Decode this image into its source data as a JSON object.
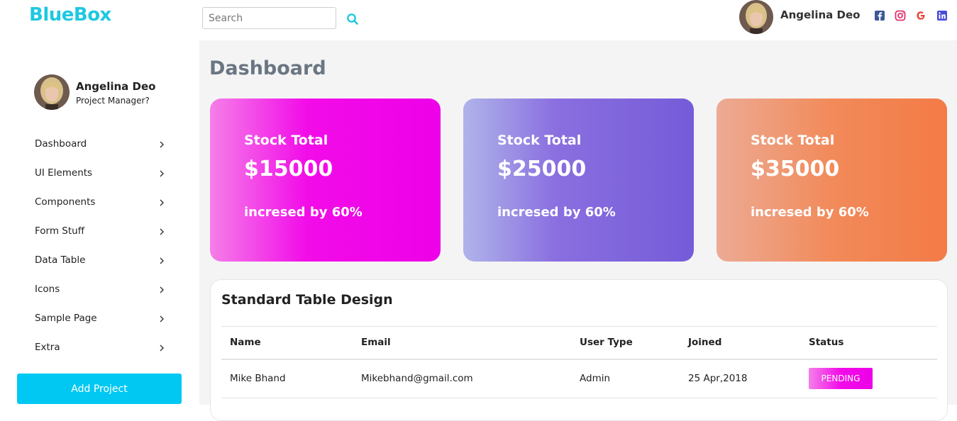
{
  "brand": {
    "name": "BlueBox"
  },
  "search": {
    "placeholder": "Search",
    "value": ""
  },
  "header": {
    "user_name": "Angelina Deo",
    "social": [
      "facebook-icon",
      "instagram-icon",
      "google-icon",
      "linkedin-icon"
    ]
  },
  "sidebar": {
    "user_name": "Angelina Deo",
    "user_role": "Project Manager?",
    "items": [
      {
        "label": "Dashboard"
      },
      {
        "label": "UI Elements"
      },
      {
        "label": "Components"
      },
      {
        "label": "Form Stuff"
      },
      {
        "label": "Data Table"
      },
      {
        "label": "Icons"
      },
      {
        "label": "Sample Page"
      },
      {
        "label": "Extra"
      }
    ],
    "add_button": "Add Project"
  },
  "main": {
    "title": "Dashboard",
    "cards": [
      {
        "label": "Stock Total",
        "value": "$15000",
        "note": "incresed by 60%"
      },
      {
        "label": "Stock Total",
        "value": "$25000",
        "note": "incresed by 60%"
      },
      {
        "label": "Stock Total",
        "value": "$35000",
        "note": "incresed by 60%"
      }
    ],
    "table": {
      "title": "Standard Table Design",
      "columns": [
        "Name",
        "Email",
        "User Type",
        "Joined",
        "Status"
      ],
      "rows": [
        {
          "name": "Mike Bhand",
          "email": "Mikebhand@gmail.com",
          "type": "Admin",
          "joined": "25 Apr,2018",
          "status": "PENDING"
        }
      ]
    }
  },
  "colors": {
    "brand": "#1ec8e0",
    "button": "#00c8f2",
    "facebook": "#3b5998",
    "instagram": "#e1306c",
    "google": "#ea4335",
    "linkedin": "#4a4ad8"
  }
}
